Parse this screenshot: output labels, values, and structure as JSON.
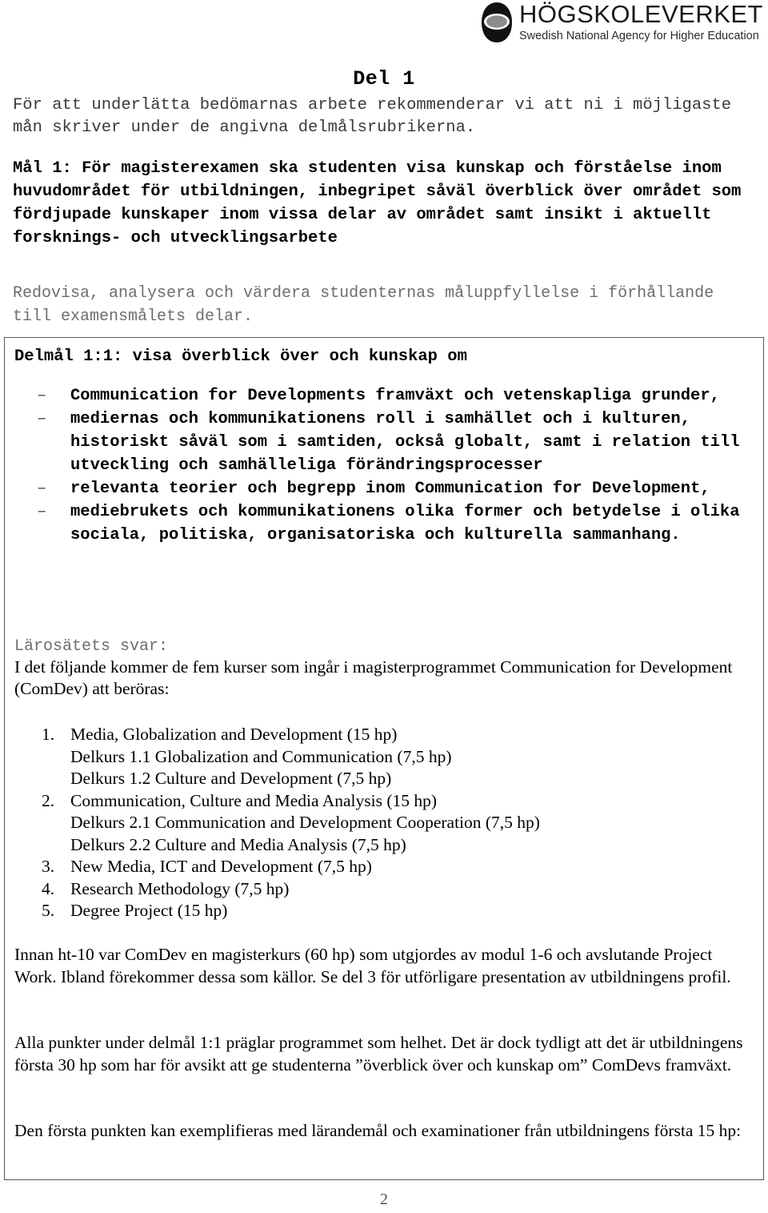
{
  "header": {
    "logo_title": "HÖGSKOLEVERKET",
    "logo_subtitle": "Swedish National Agency for Higher Education",
    "logo_icon": "eye-oval-logo-icon"
  },
  "part_title": "Del 1",
  "intro_text": "För att underlätta bedömarnas arbete rekommenderar vi att ni i möjligaste mån skriver under de angivna delmålsrubrikerna.",
  "goal_text": "Mål 1: För magisterexamen ska studenten visa kunskap och förståelse inom huvudområdet för utbildningen, inbegripet såväl överblick över området som fördjupade kunskaper inom vissa delar av området samt insikt i aktuellt forsknings- och utvecklingsarbete",
  "instruction_text": "Redovisa, analysera och värdera studenternas måluppfyllelse i förhållande till examensmålets delar.",
  "answer_box": {
    "subgoal_title": "Delmål 1:1: visa överblick över och kunskap om",
    "bullets": [
      {
        "marker": "–",
        "text": "Communication for Developments framväxt och vetenskapliga grunder,"
      },
      {
        "marker": "–",
        "text": "mediernas och kommunikationens roll i samhället och i kulturen, historiskt såväl som i samtiden, också globalt, samt i relation till utveckling och samhälleliga förändringsprocesser"
      },
      {
        "marker": "–",
        "text": "relevanta teorier och begrepp inom Communication for Development,"
      },
      {
        "marker": "–",
        "text": "mediebrukets och kommunikationens olika former och betydelse i olika sociala, politiska, organisatoriska och kulturella sammanhang."
      }
    ],
    "institution_answer_label": "Lärosätets svar:",
    "institution_answer_intro": "I det följande kommer de fem kurser som ingår i magisterprogrammet Communication for Development (ComDev) att beröras:",
    "courses": [
      {
        "num": "1.",
        "label": "Media, Globalization and Development (15 hp)",
        "subs": [
          "Delkurs 1.1 Globalization and Communication (7,5 hp)",
          "Delkurs 1.2 Culture and Development (7,5 hp)"
        ]
      },
      {
        "num": "2.",
        "label": "Communication, Culture and Media Analysis (15 hp)",
        "subs": [
          "Delkurs 2.1 Communication and Development Cooperation (7,5 hp)",
          "Delkurs 2.2 Culture and Media Analysis (7,5 hp)"
        ]
      },
      {
        "num": "3.",
        "label": "New Media, ICT and Development (7,5 hp)",
        "subs": []
      },
      {
        "num": "4.",
        "label": "Research Methodology (7,5 hp)",
        "subs": []
      },
      {
        "num": "5.",
        "label": "Degree Project (15 hp)",
        "subs": []
      }
    ],
    "paragraph_1": "Innan ht-10 var ComDev en magisterkurs (60 hp) som utgjordes av modul 1-6 och avslutande Project Work. Ibland förekommer dessa som källor. Se del 3 för utförligare presentation av utbildningens profil.",
    "paragraph_2": "Alla punkter under delmål 1:1 präglar programmet som helhet. Det är dock tydligt att det är utbildningens första 30 hp som har för avsikt att ge studenterna ”överblick över och kunskap om” ComDevs framväxt.",
    "paragraph_3": "Den första punkten kan exemplifieras med lärandemål och examinationer från utbildningens första 15 hp:"
  },
  "page_number": "2"
}
